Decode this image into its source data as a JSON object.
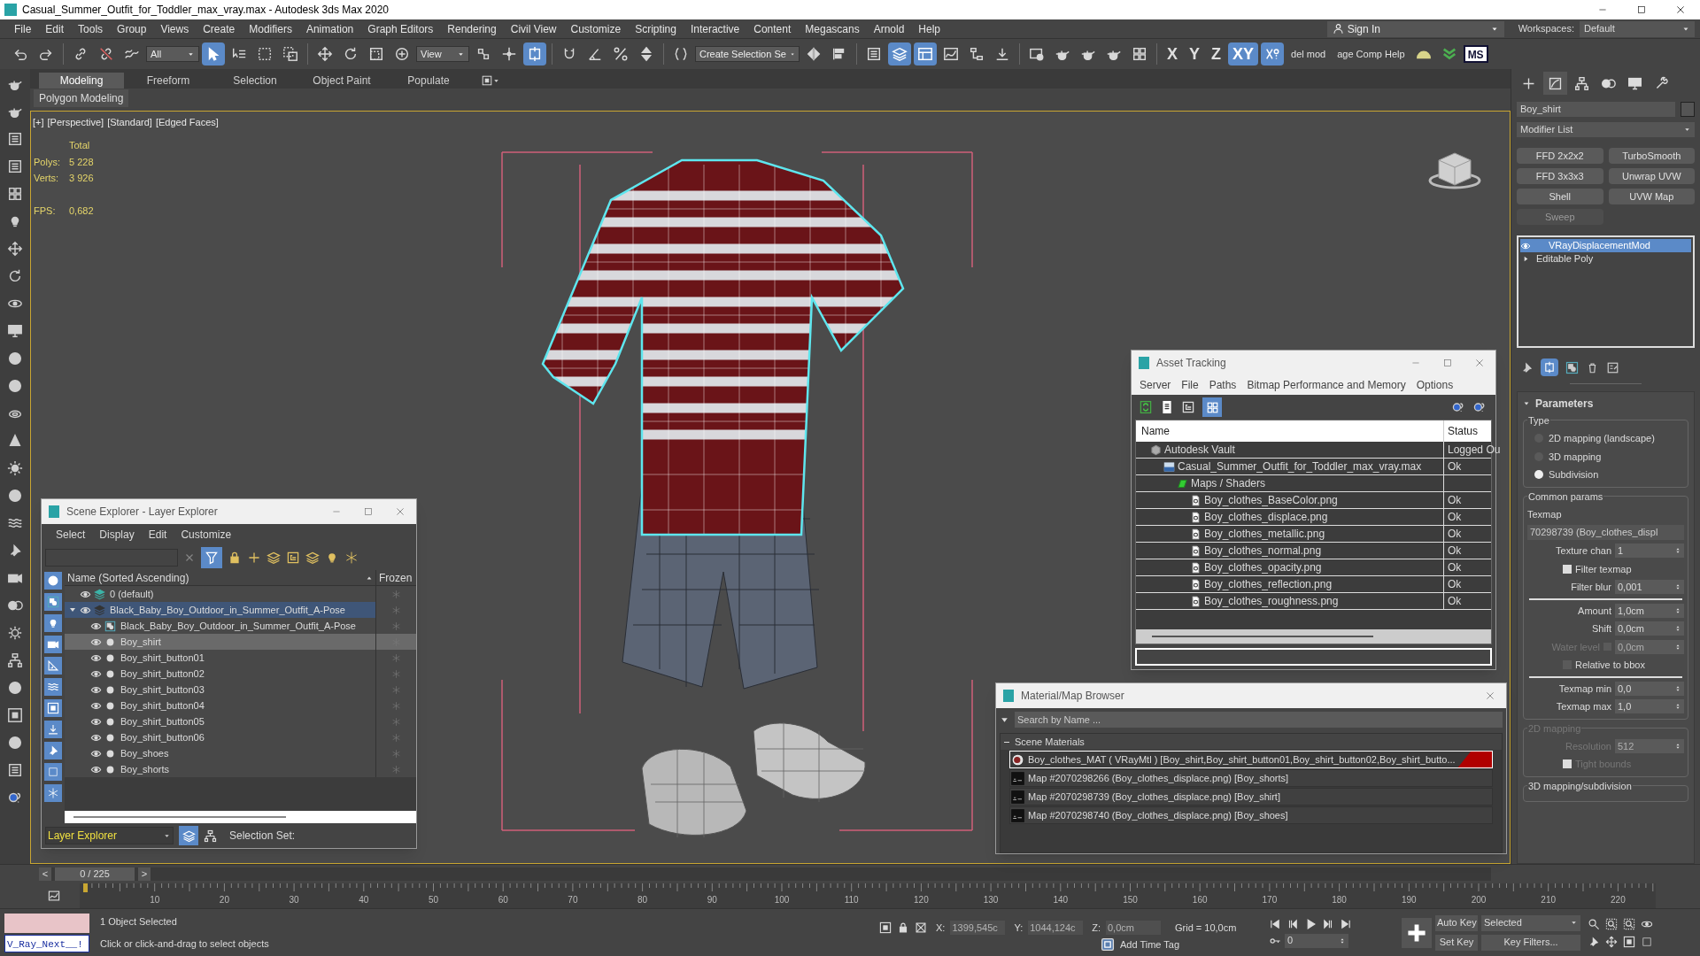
{
  "window": {
    "title": "Casual_Summer_Outfit_for_Toddler_max_vray.max - Autodesk 3ds Max 2020"
  },
  "menu_bar": {
    "items": [
      "File",
      "Edit",
      "Tools",
      "Group",
      "Views",
      "Create",
      "Modifiers",
      "Animation",
      "Graph Editors",
      "Rendering",
      "Civil View",
      "Customize",
      "Scripting",
      "Interactive",
      "Content",
      "Megascans",
      "Arnold",
      "Help"
    ],
    "sign_in": "Sign In",
    "workspaces_label": "Workspaces:",
    "workspace": "Default"
  },
  "main_toolbar": {
    "items": [
      {
        "kind": "icon",
        "active": false
      },
      {
        "kind": "icon",
        "active": false
      },
      {
        "kind": "separator"
      },
      {
        "kind": "icon",
        "active": false
      },
      {
        "kind": "icon",
        "active": false
      },
      {
        "kind": "icon",
        "active": false
      },
      {
        "kind": "dropdown",
        "value": "All"
      },
      {
        "kind": "icon",
        "active": true
      },
      {
        "kind": "icon",
        "active": false
      },
      {
        "kind": "icon",
        "active": false
      },
      {
        "kind": "icon",
        "active": false
      },
      {
        "kind": "separator"
      },
      {
        "kind": "icon",
        "active": false
      },
      {
        "kind": "icon",
        "active": false
      },
      {
        "kind": "icon",
        "active": false
      },
      {
        "kind": "icon",
        "active": false
      },
      {
        "kind": "dropdown",
        "value": "View"
      },
      {
        "kind": "icon",
        "active": false
      },
      {
        "kind": "icon",
        "active": false
      },
      {
        "kind": "icon",
        "active": true
      },
      {
        "kind": "separator"
      },
      {
        "kind": "icon",
        "active": false
      },
      {
        "kind": "icon",
        "active": false
      },
      {
        "kind": "icon",
        "active": false
      },
      {
        "kind": "icon",
        "active": false
      },
      {
        "kind": "separator"
      },
      {
        "kind": "icon",
        "active": false
      },
      {
        "kind": "dropdown",
        "value": "Create Selection Se"
      },
      {
        "kind": "icon",
        "active": false
      },
      {
        "kind": "icon",
        "active": false
      },
      {
        "kind": "separator"
      },
      {
        "kind": "icon",
        "active": false
      },
      {
        "kind": "icon",
        "active": true
      },
      {
        "kind": "icon",
        "active": true
      },
      {
        "kind": "icon",
        "active": false
      },
      {
        "kind": "icon",
        "active": false
      },
      {
        "kind": "icon",
        "active": false
      },
      {
        "kind": "separator"
      },
      {
        "kind": "icon",
        "active": false
      },
      {
        "kind": "icon",
        "active": false
      },
      {
        "kind": "icon",
        "active": false
      },
      {
        "kind": "icon",
        "active": false
      },
      {
        "kind": "icon",
        "active": false
      },
      {
        "kind": "separator"
      },
      {
        "kind": "text",
        "label": "X",
        "active": false
      },
      {
        "kind": "text",
        "label": "Y",
        "active": false
      },
      {
        "kind": "text",
        "label": "Z",
        "active": false
      },
      {
        "kind": "text",
        "label": "XY",
        "active": true
      },
      {
        "kind": "icon",
        "active": true
      },
      {
        "kind": "text",
        "label": "del mod",
        "active": false
      },
      {
        "kind": "text",
        "label": "age Comp Help",
        "active": false
      },
      {
        "kind": "icon",
        "active": false
      },
      {
        "kind": "icon",
        "active": false
      },
      {
        "kind": "badge",
        "label": "MS"
      }
    ]
  },
  "ribbon": {
    "tabs": [
      {
        "label": "Modeling",
        "selected": true
      },
      {
        "label": "Freeform",
        "selected": false
      },
      {
        "label": "Selection",
        "selected": false
      },
      {
        "label": "Object Paint",
        "selected": false
      },
      {
        "label": "Populate",
        "selected": false
      }
    ],
    "panel": "Polygon Modeling"
  },
  "viewport": {
    "labels": [
      "[+]",
      "[Perspective]",
      "[Standard]",
      "[Edged Faces]"
    ],
    "stats": {
      "heading": "Total",
      "rows": [
        {
          "label": "Polys:",
          "value": "5 228"
        },
        {
          "label": "Verts:",
          "value": "3 926"
        }
      ]
    },
    "fps": {
      "label": "FPS:",
      "value": "0,682"
    }
  },
  "command_panel": {
    "object_name": "Boy_shirt",
    "modifier_list": "Modifier List",
    "modifier_buttons": [
      {
        "label": "FFD 2x2x2",
        "disabled": false
      },
      {
        "label": "TurboSmooth",
        "disabled": false
      },
      {
        "label": "FFD 3x3x3",
        "disabled": false
      },
      {
        "label": "Unwrap UVW",
        "disabled": false
      },
      {
        "label": "Shell",
        "disabled": false
      },
      {
        "label": "UVW Map",
        "disabled": false
      },
      {
        "label": "Sweep",
        "disabled": true
      }
    ],
    "stack": [
      {
        "label": "VRayDisplacementMod",
        "selected": true,
        "kind": "modifier"
      },
      {
        "label": "Editable Poly",
        "selected": false,
        "kind": "base"
      }
    ],
    "rollout": "Parameters",
    "type_group": "Type",
    "type_options": [
      {
        "label": "2D mapping (landscape)",
        "selected": false
      },
      {
        "label": "3D mapping",
        "selected": false
      },
      {
        "label": "Subdivision",
        "selected": true
      }
    ],
    "common_group": "Common params",
    "texmap_label": "Texmap",
    "texmap": "70298739 (Boy_clothes_displ",
    "texture_chan": {
      "label": "Texture chan",
      "value": "1"
    },
    "filter_texmap": {
      "label": "Filter texmap",
      "checked": true
    },
    "filter_blur": {
      "label": "Filter blur",
      "value": "0,001"
    },
    "amount": {
      "label": "Amount",
      "value": "1,0cm"
    },
    "shift": {
      "label": "Shift",
      "value": "0,0cm"
    },
    "water_level": {
      "label": "Water level",
      "checked": false,
      "value": "0,0cm"
    },
    "relative_bbox": {
      "label": "Relative to bbox",
      "checked": false
    },
    "texmap_min": {
      "label": "Texmap min",
      "value": "0,0"
    },
    "texmap_max": {
      "label": "Texmap max",
      "value": "1,0"
    },
    "mapping_2d": {
      "title": "2D mapping",
      "resolution_label": "Resolution",
      "resolution": "512",
      "tight_bounds": {
        "label": "Tight bounds",
        "checked": true
      }
    },
    "mapping_3d_title": "3D mapping/subdivision"
  },
  "scene_explorer": {
    "title": "Scene Explorer - Layer Explorer",
    "menu": [
      "Select",
      "Display",
      "Edit",
      "Customize"
    ],
    "name_column": "Name (Sorted Ascending)",
    "frozen_column": "Frozen",
    "rows": [
      {
        "kind": "layer",
        "label": "0 (default)",
        "selected": false,
        "current": false
      },
      {
        "kind": "layer",
        "label": "Black_Baby_Boy_Outdoor_in_Summer_Outfit_A-Pose",
        "selected": false,
        "current": true,
        "expanded": true,
        "children": [
          {
            "kind": "group",
            "label": "Black_Baby_Boy_Outdoor_in_Summer_Outfit_A-Pose",
            "selected": false,
            "current": false
          },
          {
            "kind": "object",
            "label": "Boy_shirt",
            "selected": true,
            "current": false
          },
          {
            "kind": "object",
            "label": "Boy_shirt_button01",
            "selected": false,
            "current": false
          },
          {
            "kind": "object",
            "label": "Boy_shirt_button02",
            "selected": false,
            "current": false
          },
          {
            "kind": "object",
            "label": "Boy_shirt_button03",
            "selected": false,
            "current": false
          },
          {
            "kind": "object",
            "label": "Boy_shirt_button04",
            "selected": false,
            "current": false
          },
          {
            "kind": "object",
            "label": "Boy_shirt_button05",
            "selected": false,
            "current": false
          },
          {
            "kind": "object",
            "label": "Boy_shirt_button06",
            "selected": false,
            "current": false
          },
          {
            "kind": "object",
            "label": "Boy_shoes",
            "selected": false,
            "current": false
          },
          {
            "kind": "object",
            "label": "Boy_shorts",
            "selected": false,
            "current": false
          }
        ]
      }
    ],
    "explorer_type": "Layer Explorer",
    "selection_set_label": "Selection Set:"
  },
  "asset_tracking": {
    "title": "Asset Tracking",
    "menu": [
      "Server",
      "File",
      "Paths",
      "Bitmap Performance and Memory",
      "Options"
    ],
    "columns": [
      "Name",
      "Status"
    ],
    "rows": [
      {
        "kind": "vault",
        "name": "Autodesk Vault",
        "status": "Logged Ou",
        "children": [
          {
            "kind": "max_file",
            "name": "Casual_Summer_Outfit_for_Toddler_max_vray.max",
            "status": "Ok",
            "children": [
              {
                "kind": "folder",
                "name": "Maps / Shaders",
                "children": [
                  {
                    "kind": "bitmap",
                    "name": "Boy_clothes_BaseColor.png",
                    "status": "Ok"
                  },
                  {
                    "kind": "bitmap",
                    "name": "Boy_clothes_displace.png",
                    "status": "Ok"
                  },
                  {
                    "kind": "bitmap",
                    "name": "Boy_clothes_metallic.png",
                    "status": "Ok"
                  },
                  {
                    "kind": "bitmap",
                    "name": "Boy_clothes_normal.png",
                    "status": "Ok"
                  },
                  {
                    "kind": "bitmap",
                    "name": "Boy_clothes_opacity.png",
                    "status": "Ok"
                  },
                  {
                    "kind": "bitmap",
                    "name": "Boy_clothes_reflection.png",
                    "status": "Ok"
                  },
                  {
                    "kind": "bitmap",
                    "name": "Boy_clothes_roughness.png",
                    "status": "Ok"
                  }
                ]
              }
            ]
          }
        ]
      }
    ]
  },
  "material_browser": {
    "title": "Material/Map Browser",
    "search_placeholder": "Search by Name ...",
    "group": "Scene Materials",
    "group_expanded": true,
    "items": [
      {
        "kind": "material",
        "label": "Boy_clothes_MAT ( VRayMtl ) [Boy_shirt,Boy_shirt_button01,Boy_shirt_button02,Boy_shirt_butto...",
        "selected": true
      },
      {
        "kind": "map",
        "label": "Map #2070298266 (Boy_clothes_displace.png) [Boy_shorts]",
        "selected": false
      },
      {
        "kind": "map",
        "label": "Map #2070298739 (Boy_clothes_displace.png) [Boy_shirt]",
        "selected": false
      },
      {
        "kind": "map",
        "label": "Map #2070298740 (Boy_clothes_displace.png) [Boy_shoes]",
        "selected": false
      }
    ]
  },
  "timeline": {
    "prev": "<",
    "frame": "0 / 225",
    "next": ">",
    "ticks": [
      "10",
      "20",
      "30",
      "40",
      "50",
      "60",
      "70",
      "80",
      "90",
      "100",
      "110",
      "120",
      "130",
      "140",
      "150",
      "160",
      "170",
      "180",
      "190",
      "200",
      "210",
      "220"
    ]
  },
  "status_bar": {
    "script_listener": "V_Ray_Next__!",
    "selection": "1 Object Selected",
    "prompt": "Click or click-and-drag to select objects",
    "x": {
      "label": "X:",
      "value": "1399,545c"
    },
    "y": {
      "label": "Y:",
      "value": "1044,124c"
    },
    "z": {
      "label": "Z:",
      "value": "0,0cm"
    },
    "grid": "Grid = 10,0cm",
    "add_time_tag": "Add Time Tag",
    "frame": "0",
    "auto_key": "Auto Key",
    "key_mode": "Selected",
    "set_key": "Set Key",
    "key_filters": "Key Filters..."
  }
}
